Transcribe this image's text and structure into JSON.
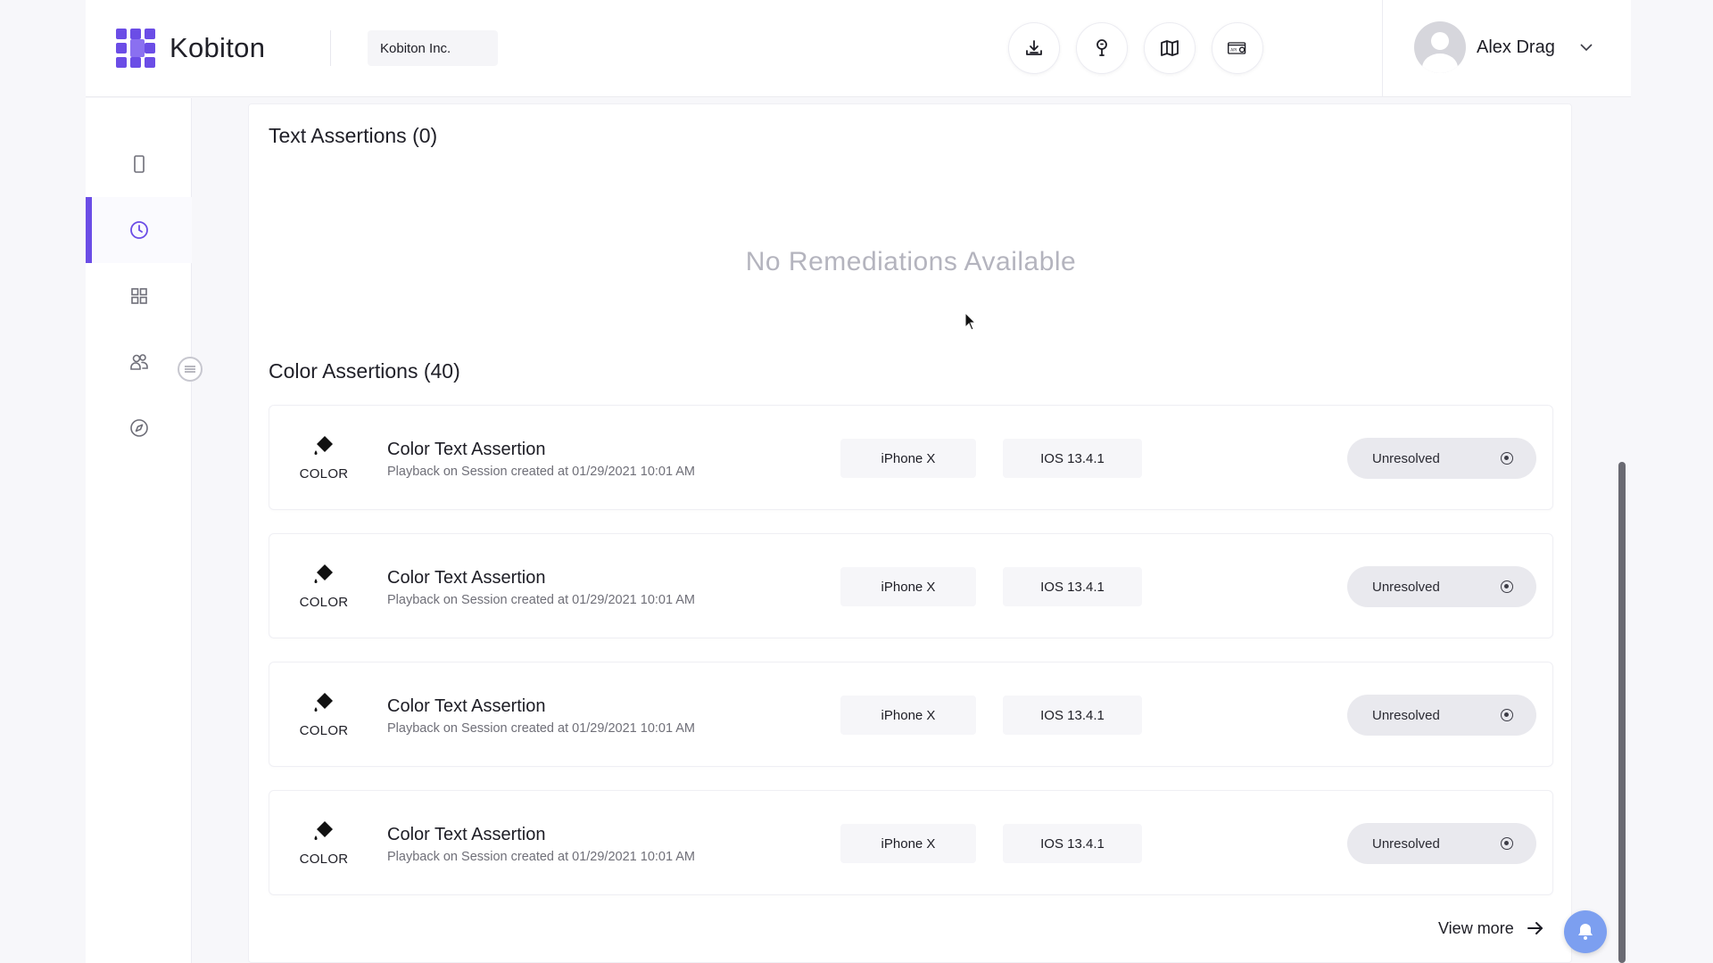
{
  "header": {
    "brand": "Kobiton",
    "org": "Kobiton Inc.",
    "actions": [
      {
        "icon": "download-icon"
      },
      {
        "icon": "help-bulb-icon"
      },
      {
        "icon": "map-icon"
      },
      {
        "icon": "api-settings-icon"
      }
    ],
    "user": {
      "name": "Alex Drag"
    }
  },
  "sidebar": {
    "items": [
      {
        "icon": "device-icon",
        "active": false
      },
      {
        "icon": "clock-icon",
        "active": true
      },
      {
        "icon": "grid-icon",
        "active": false
      },
      {
        "icon": "users-icon",
        "active": false
      },
      {
        "icon": "compass-icon",
        "active": false
      }
    ]
  },
  "main": {
    "text_assertions": {
      "title": "Text Assertions (0)",
      "empty_message": "No Remediations Available"
    },
    "color_assertions": {
      "title": "Color Assertions (40)",
      "rows": [
        {
          "type": "COLOR",
          "title": "Color Text Assertion",
          "subtitle": "Playback on Session created at 01/29/2021 10:01 AM",
          "device": "iPhone X",
          "os": "IOS 13.4.1",
          "status": "Unresolved"
        },
        {
          "type": "COLOR",
          "title": "Color Text Assertion",
          "subtitle": "Playback on Session created at 01/29/2021 10:01 AM",
          "device": "iPhone X",
          "os": "IOS 13.4.1",
          "status": "Unresolved"
        },
        {
          "type": "COLOR",
          "title": "Color Text Assertion",
          "subtitle": "Playback on Session created at 01/29/2021 10:01 AM",
          "device": "iPhone X",
          "os": "IOS 13.4.1",
          "status": "Unresolved"
        },
        {
          "type": "COLOR",
          "title": "Color Text Assertion",
          "subtitle": "Playback on Session created at 01/29/2021 10:01 AM",
          "device": "iPhone X",
          "os": "IOS 13.4.1",
          "status": "Unresolved"
        }
      ]
    },
    "view_more": "View more"
  },
  "colors": {
    "accent": "#6b4de6",
    "bell": "#7c9ff0",
    "status_bg": "#e9e9ee"
  }
}
